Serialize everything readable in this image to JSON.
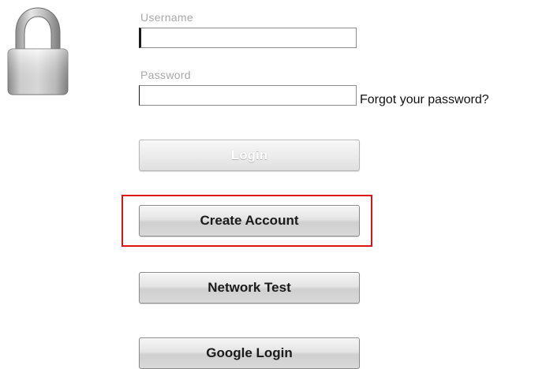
{
  "icons": {
    "lock": "padlock-icon"
  },
  "form": {
    "username_label": "Username",
    "username_value": "",
    "password_label": "Password",
    "password_value": "",
    "forgot_password_link": "Forgot your password?"
  },
  "buttons": {
    "login_label": "Login",
    "login_disabled": true,
    "create_account_label": "Create Account",
    "network_test_label": "Network Test",
    "google_login_label": "Google Login"
  },
  "highlight": {
    "target": "Create Account",
    "color": "#d9151b"
  }
}
